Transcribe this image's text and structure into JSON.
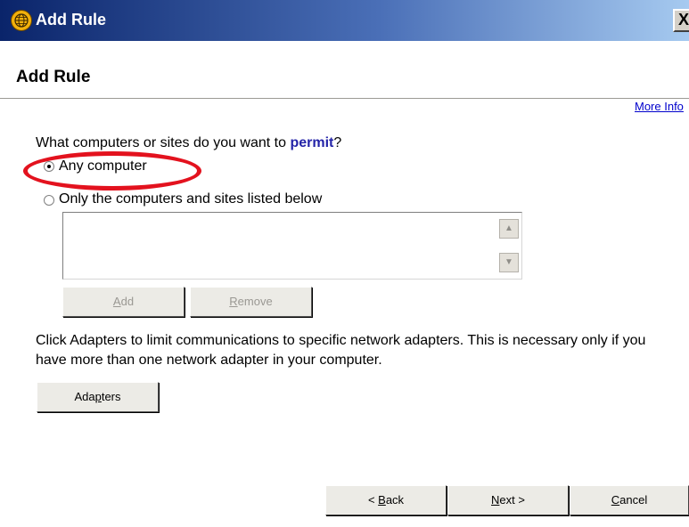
{
  "window": {
    "title": "Add Rule",
    "close_symbol": "X"
  },
  "header": {
    "title": "Add Rule"
  },
  "more_info": {
    "label": "More Info"
  },
  "question": {
    "prefix": "What computers or sites do you want to ",
    "keyword": "permit",
    "suffix": "?"
  },
  "options": [
    {
      "label": "Any computer",
      "checked": true
    },
    {
      "label": "Only the computers and sites listed below",
      "checked": false
    }
  ],
  "list_buttons": {
    "add": {
      "mnemonic": "A",
      "rest": "dd"
    },
    "remove": {
      "mnemonic": "R",
      "rest": "emove"
    }
  },
  "adapters_info": "Click Adapters to limit communications to specific network adapters. This is necessary only if you have more than one network adapter in your computer.",
  "adapters_button": {
    "before": "Ada",
    "mnemonic": "p",
    "after": "ters"
  },
  "footer": {
    "back": {
      "prefix": "< ",
      "mnemonic": "B",
      "rest": "ack"
    },
    "next": {
      "mnemonic": "N",
      "rest": "ext >"
    },
    "cancel": {
      "mnemonic": "C",
      "rest": "ancel"
    }
  },
  "annotation": {
    "color": "#e3121e"
  }
}
